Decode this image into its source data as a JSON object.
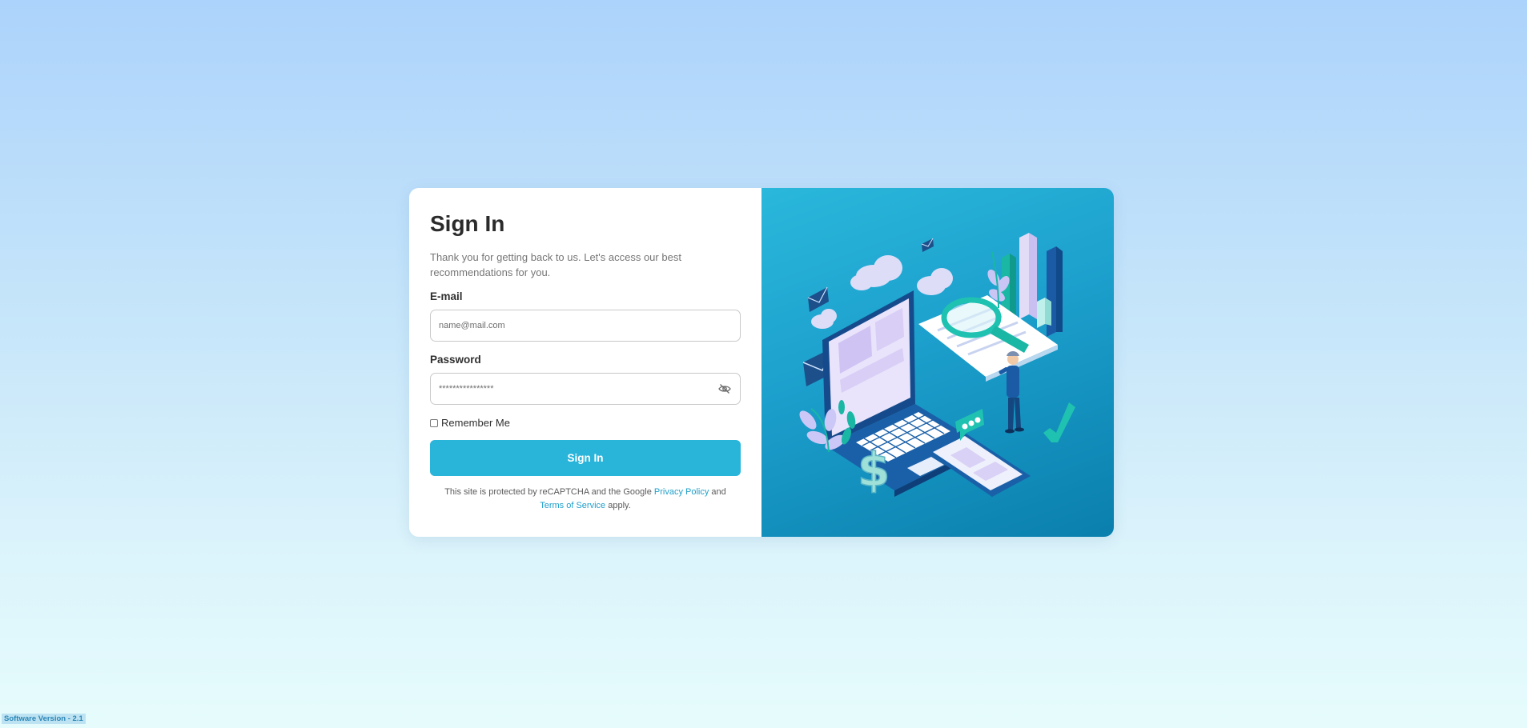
{
  "signin": {
    "title": "Sign In",
    "subtitle": "Thank you for getting back to us. Let's access our best recommendations for you.",
    "email_label": "E-mail",
    "email_placeholder": "name@mail.com",
    "password_label": "Password",
    "password_placeholder": "****************",
    "remember_label": "Remember Me",
    "button_label": "Sign In",
    "legal_prefix": "This site is protected by reCAPTCHA and the Google",
    "privacy_link": "Privacy Policy",
    "legal_and": "and",
    "terms_link": "Terms of Service",
    "legal_suffix": "apply."
  },
  "footer": {
    "version": "Software Version - 2.1"
  },
  "icons": {
    "password_toggle": "eye-off-icon"
  },
  "colors": {
    "accent": "#29b4d9",
    "link": "#1f9fcb",
    "panel_dark": "#0a7fad"
  }
}
